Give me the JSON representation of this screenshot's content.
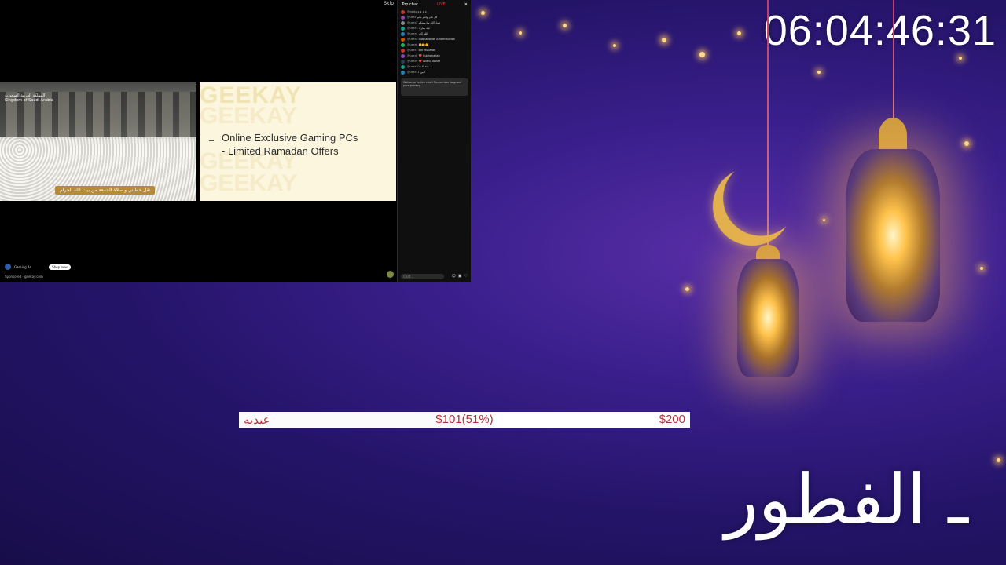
{
  "timer": "06:04:46:31",
  "stream": {
    "skip_label": "Skip",
    "left_video": {
      "logo_text_ar": "المملكة العربية السعودية",
      "logo_text_en": "Kingdom of Saudi Arabia",
      "caption": "نقل خطبتي و صلاة الجمعة من بيت الله الحرام"
    },
    "ad": {
      "brand": "GEEKAY",
      "line1": "Online Exclusive Gaming PCs",
      "line2": "- Limited Ramadan Offers"
    },
    "channel_name": "Gaming Ad",
    "follow_label": "Shop now",
    "sponsored_label": "Sponsored · geekay.com"
  },
  "chat": {
    "header_title": "Top chat",
    "header_live": "LIVE",
    "messages": [
      {
        "user": "@abdu",
        "text": "ع ع ع ع",
        "color": "#c0392b"
      },
      {
        "user": "@user",
        "text": "كل عام وانتم بخير",
        "color": "#8e44ad"
      },
      {
        "user": "@user2",
        "text": "تقبل الله منا ومنكم",
        "color": "#7f8c8d"
      },
      {
        "user": "@user3",
        "text": "عيد مبارك",
        "color": "#16a085"
      },
      {
        "user": "@user4",
        "text": "الله اكبر",
        "color": "#2980b9"
      },
      {
        "user": "@user5",
        "text": "Subhanallah Alhamdulillah",
        "color": "#d35400"
      },
      {
        "user": "@user6",
        "text": "🤲🤲🤲",
        "color": "#27ae60"
      },
      {
        "user": "@user7",
        "text": "Eid Mubarak",
        "color": "#c0392b"
      },
      {
        "user": "@user8",
        "text": "❤️ Subhanallah",
        "color": "#8e44ad"
      },
      {
        "user": "@user9",
        "text": "❤️ Allahu Akbar",
        "color": "#2c3e50"
      },
      {
        "user": "@user10",
        "text": "ما شاء الله",
        "color": "#16a085"
      },
      {
        "user": "@user11",
        "text": "آمين",
        "color": "#2980b9"
      }
    ],
    "notice": "Welcome to live chat! Remember to guard your privacy.",
    "input_placeholder": "Chat..."
  },
  "goal": {
    "label": "عيديه",
    "current": "$101(51%)",
    "target": "$200",
    "progress": 0.51
  },
  "banner_text": "ـ الفطور",
  "colors": {
    "accent_text": "#b5323a",
    "background_top": "#3a1f8c"
  }
}
